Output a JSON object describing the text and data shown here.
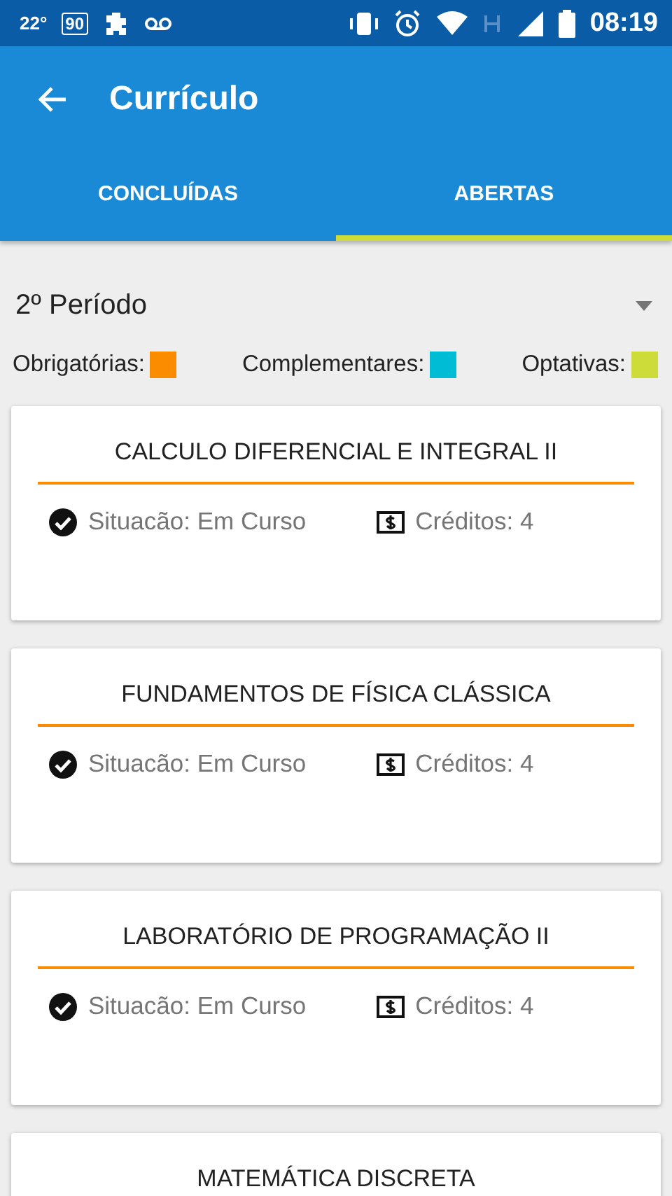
{
  "status_bar": {
    "temperature": "22°",
    "badge": "90",
    "time": "08:19"
  },
  "app_bar": {
    "title": "Currículo"
  },
  "tabs": [
    {
      "label": "CONCLUÍDAS",
      "selected": false
    },
    {
      "label": "ABERTAS",
      "selected": true
    }
  ],
  "period_select": {
    "value": "2º Período"
  },
  "legend": [
    {
      "label": "Obrigatórias:",
      "color": "#fb8c00"
    },
    {
      "label": "Complementares:",
      "color": "#00bcd4"
    },
    {
      "label": "Optativas:",
      "color": "#cddc39"
    }
  ],
  "courses": [
    {
      "title": "CALCULO DIFERENCIAL E INTEGRAL II",
      "color": "#fb8c00",
      "status": "Situacão: Em Curso",
      "credits": "Créditos: 4"
    },
    {
      "title": "FUNDAMENTOS DE FÍSICA CLÁSSICA",
      "color": "#fb8c00",
      "status": "Situacão: Em Curso",
      "credits": "Créditos: 4"
    },
    {
      "title": "LABORATÓRIO DE PROGRAMAÇÃO II",
      "color": "#fb8c00",
      "status": "Situacão: Em Curso",
      "credits": "Créditos: 4"
    },
    {
      "title": "MATEMÁTICA DISCRETA"
    }
  ]
}
